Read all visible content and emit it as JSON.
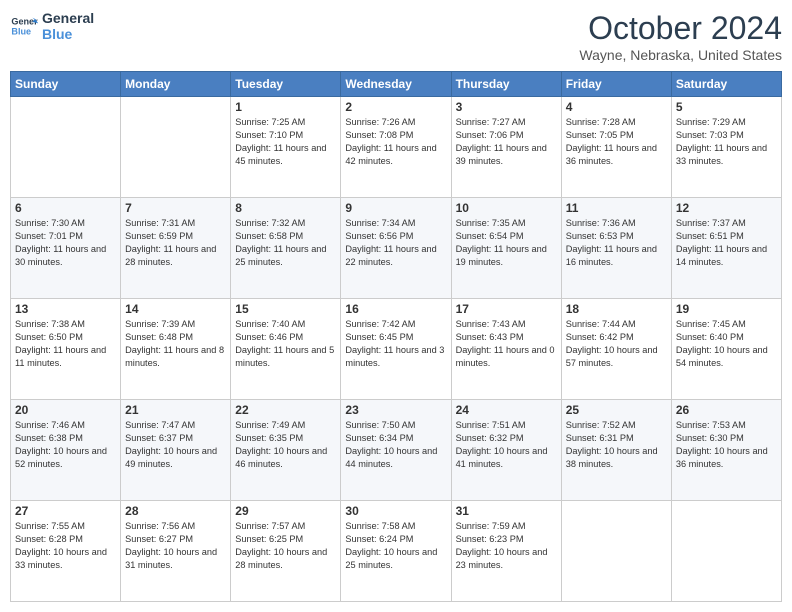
{
  "header": {
    "logo_line1": "General",
    "logo_line2": "Blue",
    "title": "October 2024",
    "location": "Wayne, Nebraska, United States"
  },
  "calendar": {
    "days_of_week": [
      "Sunday",
      "Monday",
      "Tuesday",
      "Wednesday",
      "Thursday",
      "Friday",
      "Saturday"
    ],
    "weeks": [
      [
        {
          "day": "",
          "info": ""
        },
        {
          "day": "",
          "info": ""
        },
        {
          "day": "1",
          "info": "Sunrise: 7:25 AM\nSunset: 7:10 PM\nDaylight: 11 hours and 45 minutes."
        },
        {
          "day": "2",
          "info": "Sunrise: 7:26 AM\nSunset: 7:08 PM\nDaylight: 11 hours and 42 minutes."
        },
        {
          "day": "3",
          "info": "Sunrise: 7:27 AM\nSunset: 7:06 PM\nDaylight: 11 hours and 39 minutes."
        },
        {
          "day": "4",
          "info": "Sunrise: 7:28 AM\nSunset: 7:05 PM\nDaylight: 11 hours and 36 minutes."
        },
        {
          "day": "5",
          "info": "Sunrise: 7:29 AM\nSunset: 7:03 PM\nDaylight: 11 hours and 33 minutes."
        }
      ],
      [
        {
          "day": "6",
          "info": "Sunrise: 7:30 AM\nSunset: 7:01 PM\nDaylight: 11 hours and 30 minutes."
        },
        {
          "day": "7",
          "info": "Sunrise: 7:31 AM\nSunset: 6:59 PM\nDaylight: 11 hours and 28 minutes."
        },
        {
          "day": "8",
          "info": "Sunrise: 7:32 AM\nSunset: 6:58 PM\nDaylight: 11 hours and 25 minutes."
        },
        {
          "day": "9",
          "info": "Sunrise: 7:34 AM\nSunset: 6:56 PM\nDaylight: 11 hours and 22 minutes."
        },
        {
          "day": "10",
          "info": "Sunrise: 7:35 AM\nSunset: 6:54 PM\nDaylight: 11 hours and 19 minutes."
        },
        {
          "day": "11",
          "info": "Sunrise: 7:36 AM\nSunset: 6:53 PM\nDaylight: 11 hours and 16 minutes."
        },
        {
          "day": "12",
          "info": "Sunrise: 7:37 AM\nSunset: 6:51 PM\nDaylight: 11 hours and 14 minutes."
        }
      ],
      [
        {
          "day": "13",
          "info": "Sunrise: 7:38 AM\nSunset: 6:50 PM\nDaylight: 11 hours and 11 minutes."
        },
        {
          "day": "14",
          "info": "Sunrise: 7:39 AM\nSunset: 6:48 PM\nDaylight: 11 hours and 8 minutes."
        },
        {
          "day": "15",
          "info": "Sunrise: 7:40 AM\nSunset: 6:46 PM\nDaylight: 11 hours and 5 minutes."
        },
        {
          "day": "16",
          "info": "Sunrise: 7:42 AM\nSunset: 6:45 PM\nDaylight: 11 hours and 3 minutes."
        },
        {
          "day": "17",
          "info": "Sunrise: 7:43 AM\nSunset: 6:43 PM\nDaylight: 11 hours and 0 minutes."
        },
        {
          "day": "18",
          "info": "Sunrise: 7:44 AM\nSunset: 6:42 PM\nDaylight: 10 hours and 57 minutes."
        },
        {
          "day": "19",
          "info": "Sunrise: 7:45 AM\nSunset: 6:40 PM\nDaylight: 10 hours and 54 minutes."
        }
      ],
      [
        {
          "day": "20",
          "info": "Sunrise: 7:46 AM\nSunset: 6:38 PM\nDaylight: 10 hours and 52 minutes."
        },
        {
          "day": "21",
          "info": "Sunrise: 7:47 AM\nSunset: 6:37 PM\nDaylight: 10 hours and 49 minutes."
        },
        {
          "day": "22",
          "info": "Sunrise: 7:49 AM\nSunset: 6:35 PM\nDaylight: 10 hours and 46 minutes."
        },
        {
          "day": "23",
          "info": "Sunrise: 7:50 AM\nSunset: 6:34 PM\nDaylight: 10 hours and 44 minutes."
        },
        {
          "day": "24",
          "info": "Sunrise: 7:51 AM\nSunset: 6:32 PM\nDaylight: 10 hours and 41 minutes."
        },
        {
          "day": "25",
          "info": "Sunrise: 7:52 AM\nSunset: 6:31 PM\nDaylight: 10 hours and 38 minutes."
        },
        {
          "day": "26",
          "info": "Sunrise: 7:53 AM\nSunset: 6:30 PM\nDaylight: 10 hours and 36 minutes."
        }
      ],
      [
        {
          "day": "27",
          "info": "Sunrise: 7:55 AM\nSunset: 6:28 PM\nDaylight: 10 hours and 33 minutes."
        },
        {
          "day": "28",
          "info": "Sunrise: 7:56 AM\nSunset: 6:27 PM\nDaylight: 10 hours and 31 minutes."
        },
        {
          "day": "29",
          "info": "Sunrise: 7:57 AM\nSunset: 6:25 PM\nDaylight: 10 hours and 28 minutes."
        },
        {
          "day": "30",
          "info": "Sunrise: 7:58 AM\nSunset: 6:24 PM\nDaylight: 10 hours and 25 minutes."
        },
        {
          "day": "31",
          "info": "Sunrise: 7:59 AM\nSunset: 6:23 PM\nDaylight: 10 hours and 23 minutes."
        },
        {
          "day": "",
          "info": ""
        },
        {
          "day": "",
          "info": ""
        }
      ]
    ]
  }
}
